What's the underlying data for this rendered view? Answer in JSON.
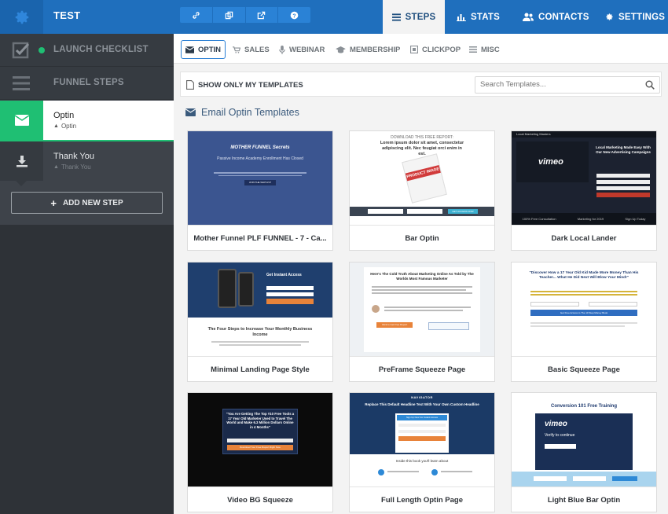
{
  "header": {
    "funnel_name": "TEST",
    "tabs": [
      {
        "label": "STEPS",
        "icon": "list-icon",
        "active": true
      },
      {
        "label": "STATS",
        "icon": "bar-chart-icon",
        "active": false
      },
      {
        "label": "CONTACTS",
        "icon": "users-icon",
        "active": false
      },
      {
        "label": "SETTINGS",
        "icon": "gear-icon",
        "active": false
      }
    ],
    "tool_icons": [
      "link-icon",
      "copy-icon",
      "external-link-icon",
      "help-icon"
    ]
  },
  "sidebar": {
    "launch_checklist": "LAUNCH CHECKLIST",
    "funnel_steps": "FUNNEL STEPS",
    "steps": [
      {
        "title": "Optin",
        "subtitle": "Optin",
        "active": true
      },
      {
        "title": "Thank You",
        "subtitle": "Thank You",
        "active": false
      }
    ],
    "add_step_label": "ADD NEW STEP"
  },
  "subnav": {
    "tabs": [
      {
        "label": "OPTIN",
        "icon": "envelope-icon",
        "active": true
      },
      {
        "label": "SALES",
        "icon": "cart-icon",
        "active": false
      },
      {
        "label": "WEBINAR",
        "icon": "microphone-icon",
        "active": false
      },
      {
        "label": "MEMBERSHIP",
        "icon": "graduation-cap-icon",
        "active": false
      },
      {
        "label": "CLICKPOP",
        "icon": "popup-icon",
        "active": false
      },
      {
        "label": "MISC",
        "icon": "menu-icon",
        "active": false
      }
    ]
  },
  "filter": {
    "show_mine_label": "SHOW ONLY MY TEMPLATES",
    "search_placeholder": "Search Templates..."
  },
  "section_title": "Email Optin Templates",
  "templates": [
    {
      "name": "Mother Funnel PLF FUNNEL - 7 - Ca...",
      "thumb_title": "MOTHER FUNNEL Secrets",
      "thumb_heading": "Passive Income Academy Enrollment Has Closed",
      "thumb_button": "JOIN THE WAITLIST"
    },
    {
      "name": "Bar Optin",
      "thumb_title": "DOWNLOAD THIS FREE REPORT:",
      "thumb_heading": "Lorem ipsum dolor sit amet, consectetur adipiscing elit. Nec feugiat orci enim in est.",
      "thumb_book": "PRODUCT IMAGE",
      "thumb_button": "GET ACCESS NOW"
    },
    {
      "name": "Dark Local Lander",
      "thumb_title": "Local Marketing Masters",
      "thumb_heading": "Local Marketing Made Easy With Our New Advertising Campaigns",
      "thumb_brand": "vimeo",
      "thumb_footer": [
        "100% Free Consultation",
        "Marketing for 2019",
        "Sign Up Today"
      ]
    },
    {
      "name": "Minimal Landing Page Style",
      "thumb_heading": "Get Instant Access",
      "thumb_sub": "The Four Steps to Increase Your Monthly Business Income"
    },
    {
      "name": "PreFrame Squeeze Page",
      "thumb_heading": "Here's The Cold Truth About Marketing Online As Told by The Worlds Most Famous Marketer",
      "thumb_button": "Click to Get Free Report"
    },
    {
      "name": "Basic Squeeze Page",
      "thumb_heading": "\"Discover How a 17 Year Old Kid Made More Money Than His Teacher... What He Did Next Will Blow Your Mind!\"",
      "thumb_button": "Get Free Access to The 10 Step Money Book"
    },
    {
      "name": "Video BG Squeeze",
      "thumb_heading": "\"You Are Getting The Top #10 Free Tools a 17 Year Old Marketer Used to Travel The World and Make 6.3 Million Dollars Online in 4 Months\"",
      "thumb_button": "Download Your Free Report Right Now"
    },
    {
      "name": "Full Length Optin Page",
      "thumb_brand": "NAVIGATOR",
      "thumb_heading": "Replace This Default Headline Text With Your Own Custom Headline",
      "thumb_sub": "Inside this book you'll learn about",
      "thumb_button": "Sign Up Now For Instant Access"
    },
    {
      "name": "Light Blue Bar Optin",
      "thumb_title": "Conversion 101 Free Training",
      "thumb_brand": "vimeo",
      "thumb_heading": "Verify to continue"
    }
  ],
  "colors": {
    "topbar": "#1f6fbd",
    "sidebar": "#3e434a",
    "accent_green": "#1fbf73",
    "active_blue": "#2a7fd4"
  }
}
